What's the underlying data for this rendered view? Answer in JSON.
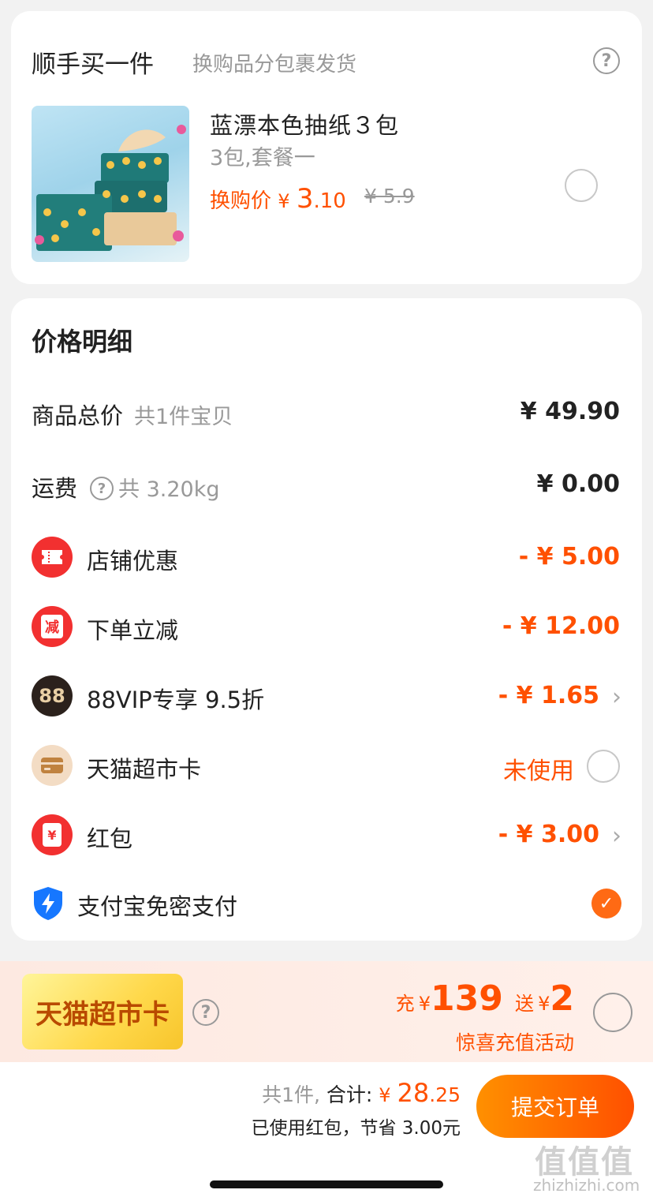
{
  "addon": {
    "title": "顺手买一件",
    "subtitle": "换购品分包裹发货",
    "product": {
      "name": "蓝漂本色抽纸３包",
      "spec": "3包,套餐一",
      "price_label": "换购价",
      "price_symbol": "¥",
      "price_int": "3",
      "price_dec": ".10",
      "original_price": "¥ 5.9"
    }
  },
  "detail": {
    "title": "价格明细",
    "rows": [
      {
        "label": "商品总价",
        "sub": "共1件宝贝",
        "value": "¥ 49.90"
      },
      {
        "label": "运费",
        "sub": "共 3.20kg",
        "value": "¥ 0.00"
      },
      {
        "label": "店铺优惠",
        "value": "- ¥ 5.00",
        "icon": "ticket-icon",
        "icon_color": "#f23030"
      },
      {
        "label": "下单立减",
        "value": "- ¥ 12.00",
        "icon": "jian-badge-icon",
        "icon_text": "减",
        "icon_color": "#f23030"
      },
      {
        "label": "88VIP专享 9.5折",
        "value": "- ¥ 1.65",
        "icon": "vip88-icon",
        "icon_text": "88",
        "icon_color": "#2b211c"
      },
      {
        "label": "天猫超市卡",
        "value": "未使用",
        "icon": "card-icon",
        "icon_color": "#f3dcc4"
      },
      {
        "label": "红包",
        "value": "- ¥ 3.00",
        "icon": "red-packet-icon",
        "icon_text": "¥",
        "icon_color": "#f23030"
      },
      {
        "label": "支付宝免密支付",
        "icon": "shield-bolt-icon",
        "icon_color": "#1677ff"
      }
    ]
  },
  "tmall_card": {
    "badge": "天猫超市卡",
    "recharge_prefix": "充",
    "recharge_symbol": "¥",
    "recharge_amount": "139",
    "gift_prefix": "送",
    "gift_symbol": "¥",
    "gift_amount": "2",
    "subtitle": "惊喜充值活动"
  },
  "bottom": {
    "count": "共1件,",
    "total_label": "合计:",
    "total_symbol": "¥",
    "total_int": "28",
    "total_dec": ".25",
    "saved": "已使用红包，节省 3.00元",
    "submit": "提交订单"
  },
  "watermark": {
    "logo": "值值值",
    "site": "zhizhizhi.com"
  },
  "colors": {
    "accent": "#ff5000",
    "gradient_start": "#ff9000"
  }
}
